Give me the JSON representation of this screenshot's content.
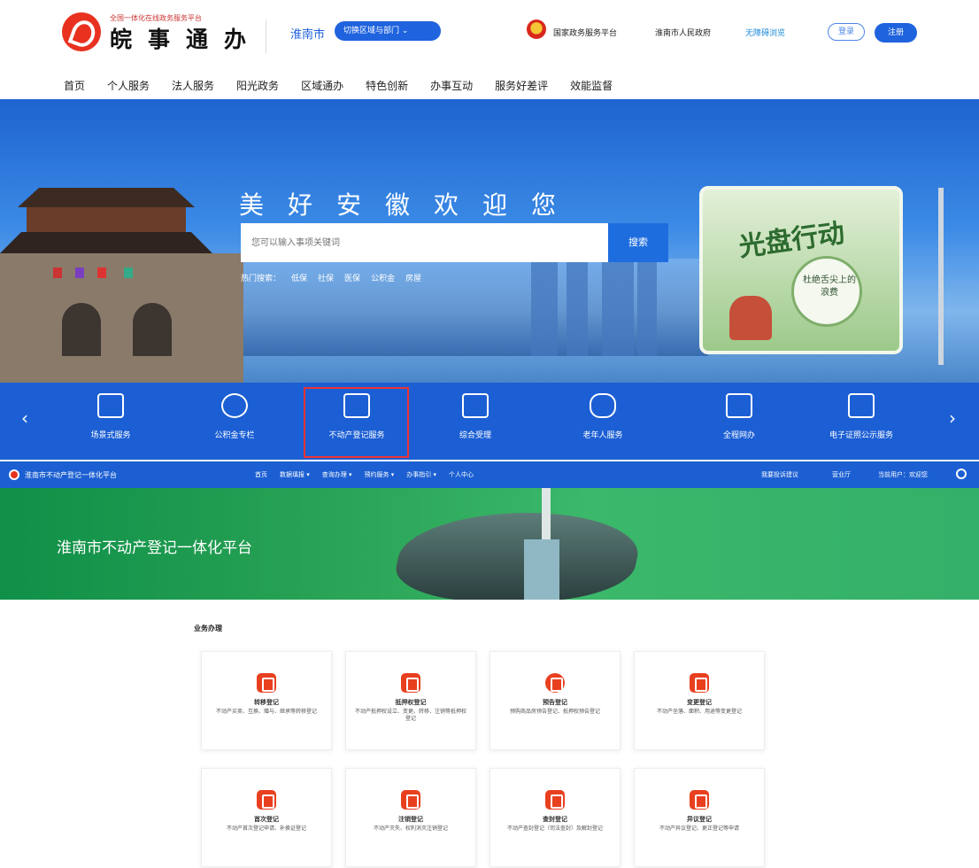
{
  "header": {
    "logo_subtitle": "全国一体化在线政务服务平台",
    "logo_title": "皖事通办",
    "city": "淮南市",
    "switch_label": "切换区域与部门",
    "links": [
      "国家政务服务平台",
      "淮南市人民政府",
      "无障碍浏览"
    ],
    "login": "登录",
    "register": "注册"
  },
  "nav": [
    "首页",
    "个人服务",
    "法人服务",
    "阳光政务",
    "区域通办",
    "特色创新",
    "办事互动",
    "服务好差评",
    "效能监督"
  ],
  "banner": {
    "slogan": "美好安徽欢迎您",
    "search_placeholder": "您可以输入事项关键词",
    "search_button": "搜索",
    "hot_label": "热门搜索：",
    "hot_terms": [
      "低保",
      "社保",
      "医保",
      "公积金",
      "房屋"
    ],
    "promo_title": "光盘行动",
    "promo_text": "杜绝舌尖上的浪费"
  },
  "services": [
    "场景式服务",
    "公积金专栏",
    "不动产登记服务",
    "综合受理",
    "老年人服务",
    "全程网办",
    "电子证照公示服务"
  ],
  "subplatform": {
    "name": "淮南市不动产登记一体化平台",
    "nav": [
      "首页",
      "数据填报 ▾",
      "查询办理 ▾",
      "预约服务 ▾",
      "办事指引 ▾",
      "个人中心"
    ],
    "right": [
      "我要投诉建议",
      "营业厅",
      "当前用户：欢迎您"
    ],
    "hero_title": "淮南市不动产登记一体化平台",
    "section_title": "业务办理",
    "cards": [
      {
        "name": "转移登记",
        "desc": "不动产买卖、互换、赠与、继承等转移登记"
      },
      {
        "name": "抵押权登记",
        "desc": "不动产抵押权设立、变更、转移、注销等抵押权登记"
      },
      {
        "name": "预告登记",
        "desc": "预购商品房预告登记、抵押权预告登记"
      },
      {
        "name": "变更登记",
        "desc": "不动产坐落、面积、用途等变更登记"
      },
      {
        "name": "首次登记",
        "desc": "不动产首次登记申请、补换证登记"
      },
      {
        "name": "注销登记",
        "desc": "不动产灭失、权利消灭注销登记"
      },
      {
        "name": "查封登记",
        "desc": "不动产查封登记（司法查封）及解封登记"
      },
      {
        "name": "异议登记",
        "desc": "不动产异议登记、更正登记等申请"
      }
    ]
  }
}
